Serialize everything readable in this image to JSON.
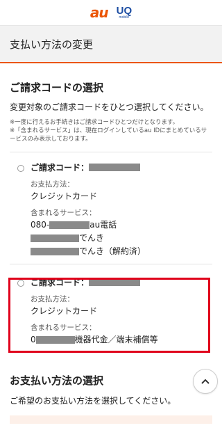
{
  "header": {
    "logo_au": "au",
    "logo_uq": "UQ",
    "logo_uq_sub": "mobile"
  },
  "page_title": "支払い方法の変更",
  "section1": {
    "title": "ご請求コードの選択",
    "description": "変更対象のご請求コードをひとつ選択してください。",
    "notes": [
      "※一度に行えるお手続きはご請求コードひとつだけとなります。",
      "※「含まれるサービス」は、現在ログインしているau IDにまとめているサービスのみ表示しております。"
    ]
  },
  "cards": [
    {
      "code_label": "ご請求コード：",
      "payment_label": "お支払方法：",
      "payment_value": "クレジットカード",
      "services_label": "含まれるサービス：",
      "services": [
        {
          "prefix": "080-",
          "suffix": " au電話"
        },
        {
          "prefix": "",
          "suffix": " でんき"
        },
        {
          "prefix": "",
          "suffix": " でんき（解約済）"
        }
      ]
    },
    {
      "code_label": "ご請求コード：",
      "payment_label": "お支払方法：",
      "payment_value": "クレジットカード",
      "services_label": "含まれるサービス：",
      "services": [
        {
          "prefix": "0",
          "suffix": " 機器代金／端末補償等"
        }
      ]
    }
  ],
  "section2": {
    "title": "お支払い方法の選択",
    "description": "ご希望のお支払い方法を選択してください。"
  },
  "scroll_top_icon": "chevron-up-icon",
  "colors": {
    "accent": "#eb5505",
    "highlight": "#e0001b",
    "uq_blue": "#1d4ea3"
  }
}
